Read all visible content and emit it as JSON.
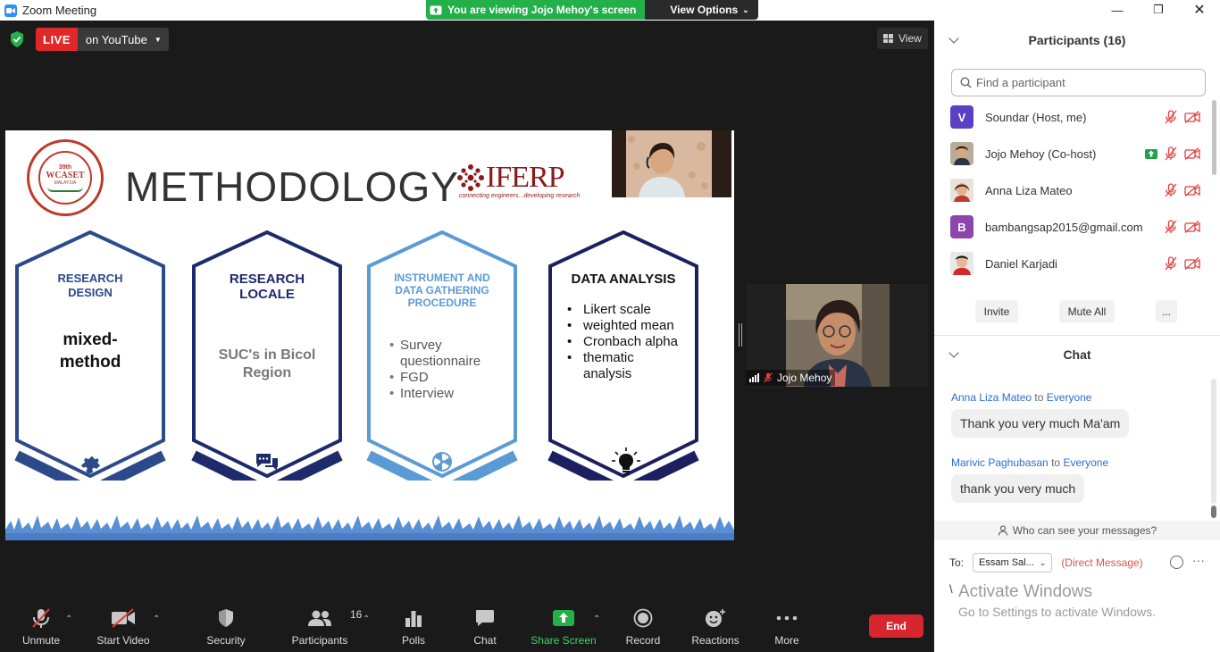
{
  "window": {
    "title": "Zoom Meeting"
  },
  "share_banner": {
    "status": "You are viewing Jojo Mehoy's screen",
    "view_options": "View Options"
  },
  "live": {
    "badge": "LIVE",
    "destination": "on YouTube"
  },
  "view_button": "View",
  "slide": {
    "heading": "METHODOLOGY",
    "left_logo": {
      "number": "39th",
      "name": "WCASET",
      "sub": "MALAYSIA"
    },
    "brand": {
      "name": "IFERP",
      "tagline": "connecting engineers...developing research"
    },
    "cards": [
      {
        "title_lines": [
          "RESEARCH",
          "DESIGN"
        ],
        "body_lines": [
          "mixed-",
          "method"
        ],
        "icon": "puzzle-icon",
        "color": "#2c4a8a"
      },
      {
        "title_lines": [
          "RESEARCH",
          "LOCALE"
        ],
        "body_lines": [
          "SUC's in Bicol",
          "Region"
        ],
        "icon": "chat-bubbles-icon",
        "color": "#1d2a6b"
      },
      {
        "title_lines": [
          "INSTRUMENT AND",
          "DATA GATHERING",
          "PROCEDURE"
        ],
        "bullets": [
          "Survey",
          "questionnaire",
          "FGD",
          "Interview"
        ],
        "icon": "radiation-icon",
        "color": "#5b9bd5"
      },
      {
        "title_lines": [
          "DATA ANALYSIS"
        ],
        "bullets": [
          "Likert scale",
          "weighted mean",
          "Cronbach alpha",
          "thematic",
          "analysis"
        ],
        "icon": "lightbulb-icon",
        "color": "#1d2060"
      }
    ]
  },
  "video_tile": {
    "name": "Jojo Mehoy"
  },
  "toolbar": {
    "unmute": "Unmute",
    "start_video": "Start Video",
    "security": "Security",
    "participants": "Participants",
    "participants_count": "16",
    "polls": "Polls",
    "chat": "Chat",
    "share_screen": "Share Screen",
    "record": "Record",
    "reactions": "Reactions",
    "more": "More",
    "end": "End"
  },
  "participants_panel": {
    "header": "Participants (16)",
    "search_placeholder": "Find a participant",
    "participants": [
      {
        "name": "Soundar (Host, me)",
        "initial": "V",
        "avatar_color": "#5b3fc4"
      },
      {
        "name": "Jojo Mehoy (Co-host)",
        "initial": "",
        "avatar_color": "#8a7a6a"
      },
      {
        "name": "Anna Liza Mateo",
        "initial": "",
        "avatar_color": "#a0524a"
      },
      {
        "name": "bambangsap2015@gmail.com",
        "initial": "B",
        "avatar_color": "#8e44ad"
      },
      {
        "name": "Daniel Karjadi",
        "initial": "",
        "avatar_color": "#c0392b"
      }
    ],
    "buttons": {
      "invite": "Invite",
      "mute_all": "Mute All",
      "more": "..."
    }
  },
  "chat_panel": {
    "header": "Chat",
    "messages": [
      {
        "from": "Anna Liza Mateo",
        "to_word": "to",
        "to": "Everyone",
        "text": "Thank you very much Ma'am"
      },
      {
        "from": "Marivic Paghubasan",
        "to_word": "to",
        "to": "Everyone",
        "text": "thank you very much"
      }
    ],
    "who_can_see": "Who can see your messages?",
    "to_label": "To:",
    "recipient": "Essam Sal...",
    "direct_message": "(Direct Message)",
    "input_value": "\\"
  },
  "watermark": {
    "line1": "Activate Windows",
    "line2": "Go to Settings to activate Windows."
  }
}
